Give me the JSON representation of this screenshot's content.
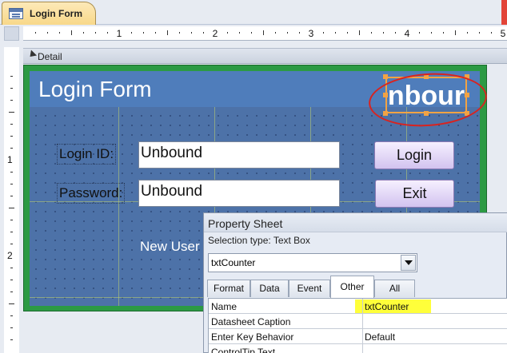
{
  "document_tab": {
    "title": "Login Form",
    "icon": "form-icon"
  },
  "ruler": {
    "horizontal_numbers": [
      "1",
      "2",
      "3",
      "4",
      "5"
    ],
    "vertical_numbers": [
      "1",
      "2"
    ]
  },
  "section": {
    "label": "Detail"
  },
  "form": {
    "title": "Login Form",
    "counter_text": "nbour",
    "login_id_label": "Login ID:",
    "login_id_value": "Unbound",
    "password_label": "Password:",
    "password_value": "Unbound",
    "login_button": "Login",
    "exit_button": "Exit",
    "new_user_label": "New User",
    "colors": {
      "header": "#4f7dbb",
      "frame": "#2c9a44",
      "button": "#d2c3ef",
      "selection": "#f2a344",
      "annotation": "#d9231f"
    }
  },
  "property_sheet": {
    "title": "Property Sheet",
    "selection_type": "Selection type:  Text Box",
    "selected_control": "txtCounter",
    "tabs": [
      "Format",
      "Data",
      "Event",
      "Other",
      "All"
    ],
    "active_tab": "Other",
    "rows": [
      {
        "name": "Name",
        "value": "txtCounter"
      },
      {
        "name": "Datasheet Caption",
        "value": ""
      },
      {
        "name": "Enter Key Behavior",
        "value": "Default"
      },
      {
        "name": "ControlTip Text",
        "value": ""
      }
    ],
    "highlight_color": "#ffff3a"
  }
}
